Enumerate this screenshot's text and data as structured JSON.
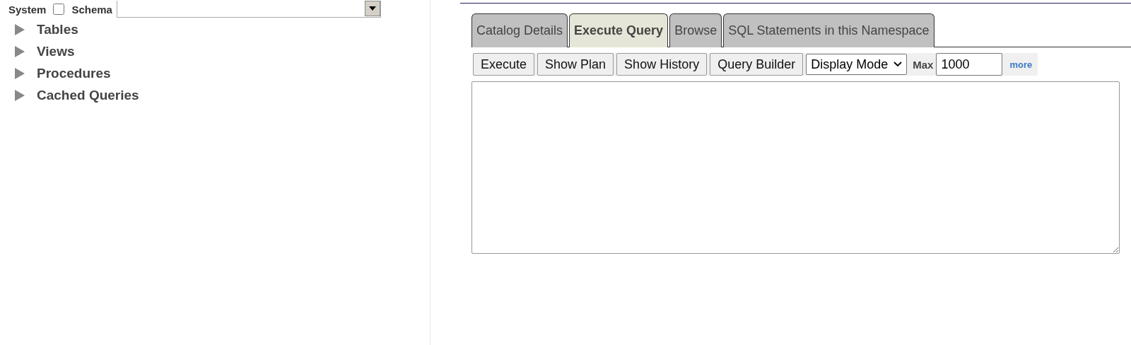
{
  "filter": {
    "system_label": "System",
    "system_checked": false,
    "schema_label": "Schema"
  },
  "tree": [
    {
      "label": "Tables",
      "expanded": false
    },
    {
      "label": "Views",
      "expanded": false
    },
    {
      "label": "Procedures",
      "expanded": false
    },
    {
      "label": "Cached Queries",
      "expanded": false
    }
  ],
  "tabs": [
    {
      "label": "Catalog Details",
      "selected": false
    },
    {
      "label": "Execute Query",
      "selected": true
    },
    {
      "label": "Browse",
      "selected": false
    },
    {
      "label": "SQL Statements in this Namespace",
      "selected": false
    }
  ],
  "toolbar": {
    "buttons": [
      "Execute",
      "Show Plan",
      "Show History",
      "Query Builder"
    ],
    "display_mode": "Display Mode",
    "max_label": "Max",
    "max_value": "1000",
    "more_link": "more"
  }
}
